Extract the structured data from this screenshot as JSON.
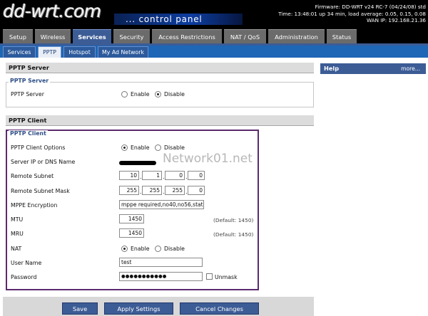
{
  "header": {
    "logo_text": "dd-wrt.com",
    "control_panel_text": "... control panel",
    "firmware": "Firmware: DD-WRT v24 RC-7 (04/24/08) std",
    "time": "Time: 13:48:01 up 34 min, load average: 0.05, 0.15, 0.08",
    "wan_ip": "WAN IP: 192.168.21.36"
  },
  "main_tabs": [
    "Setup",
    "Wireless",
    "Services",
    "Security",
    "Access Restrictions",
    "NAT / QoS",
    "Administration",
    "Status"
  ],
  "main_tab_active": "Services",
  "sub_tabs": [
    "Services",
    "PPTP",
    "Hotspot",
    "My Ad Network"
  ],
  "sub_tab_active": "PPTP",
  "pptp_server": {
    "section_title": "PPTP Server",
    "legend": "PPTP Server",
    "label": "PPTP Server",
    "enable_label": "Enable",
    "disable_label": "Disable",
    "selected": "Disable"
  },
  "pptp_client": {
    "section_title": "PPTP Client",
    "legend": "PPTP Client",
    "options_label": "PPTP Client Options",
    "options_enable": "Enable",
    "options_disable": "Disable",
    "options_selected": "Enable",
    "server_label": "Server IP or DNS Name",
    "remote_subnet_label": "Remote Subnet",
    "remote_subnet": [
      "10",
      "1",
      "0",
      "0"
    ],
    "remote_mask_label": "Remote Subnet Mask",
    "remote_mask": [
      "255",
      "255",
      "255",
      "0"
    ],
    "mppe_label": "MPPE Encryption",
    "mppe_value": "mppe required,no40,no56,stateless",
    "mtu_label": "MTU",
    "mtu_value": "1450",
    "mtu_default": "(Default: 1450)",
    "mru_label": "MRU",
    "mru_value": "1450",
    "mru_default": "(Default: 1450)",
    "nat_label": "NAT",
    "nat_enable": "Enable",
    "nat_disable": "Disable",
    "nat_selected": "Enable",
    "username_label": "User Name",
    "username_value": "test",
    "password_label": "Password",
    "password_value": "●●●●●●●●●●●",
    "unmask_label": "Unmask"
  },
  "watermark": "Network01.net",
  "help": {
    "title": "Help",
    "more": "more..."
  },
  "footer": {
    "save": "Save",
    "apply": "Apply Settings",
    "cancel": "Cancel Changes"
  },
  "colors": {
    "accent_blue": "#3c5c96",
    "subtab_bar": "#1e66b6",
    "client_outline": "#5b2a6e"
  }
}
